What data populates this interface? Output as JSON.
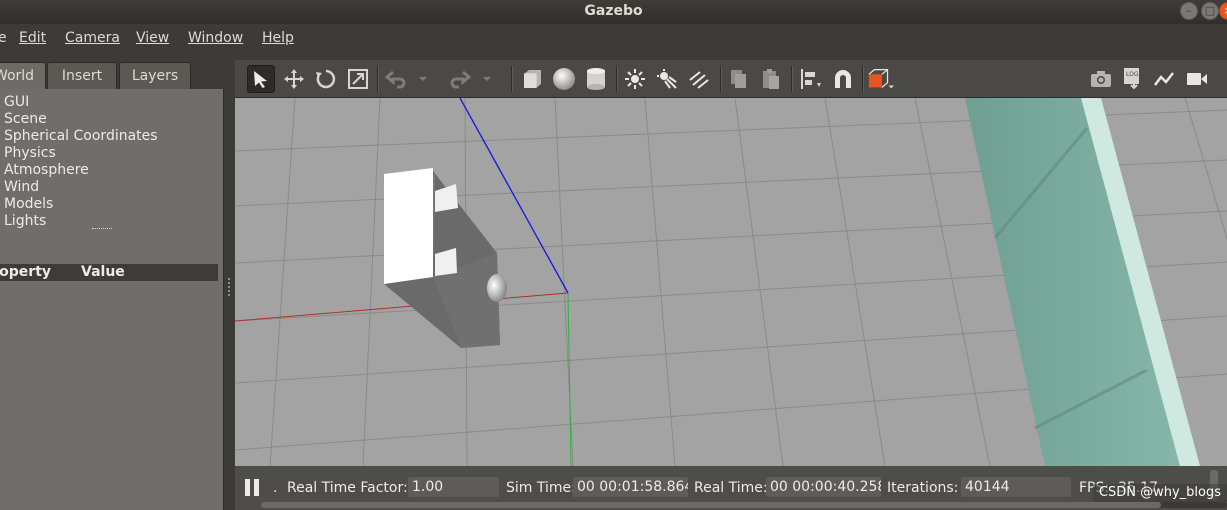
{
  "window": {
    "title": "Gazebo"
  },
  "menu": {
    "items": [
      {
        "label": "File",
        "shown": "e"
      },
      {
        "label": "Edit"
      },
      {
        "label": "Camera"
      },
      {
        "label": "View"
      },
      {
        "label": "Window"
      },
      {
        "label": "Help"
      }
    ]
  },
  "left_panel": {
    "tabs": [
      {
        "label": "World",
        "active": true
      },
      {
        "label": "Insert",
        "active": false
      },
      {
        "label": "Layers",
        "active": false
      }
    ],
    "tree": [
      "GUI",
      "Scene",
      "Spherical Coordinates",
      "Physics",
      "Atmosphere",
      "Wind",
      "Models",
      "Lights"
    ],
    "property_header": {
      "property": "Property",
      "value": "Value"
    }
  },
  "toolbar": {
    "icons": [
      "select-arrow-icon",
      "translate-icon",
      "rotate-icon",
      "scale-icon",
      "undo-icon",
      "undo-history-icon",
      "redo-icon",
      "redo-history-icon",
      "box-icon",
      "sphere-icon",
      "cylinder-icon",
      "point-light-icon",
      "spot-light-icon",
      "directional-light-icon",
      "copy-icon",
      "paste-icon",
      "align-icon",
      "magnet-snap-icon",
      "view-angle-icon",
      "screenshot-icon",
      "log-icon",
      "plot-icon",
      "video-record-icon"
    ]
  },
  "status": {
    "real_time_factor_label": "Real Time Factor:",
    "real_time_factor": "1.00",
    "sim_time_label": "Sim Time:",
    "sim_time": "00 00:01:58.864",
    "real_time_label": "Real Time:",
    "real_time": "00 00:00:40.258",
    "iterations_label": "Iterations:",
    "iterations": "40144",
    "fps_label": "FPS:",
    "fps": "35.17",
    "step_label": "."
  },
  "watermark": "CSDN @why_blogs",
  "colors": {
    "accent_orange": "#e95420",
    "x_axis": "#c0392b",
    "y_axis": "#2ecc40",
    "z_axis": "#1a1aff",
    "ground": "#a3a3a3",
    "wall": "#7fb0a4"
  }
}
